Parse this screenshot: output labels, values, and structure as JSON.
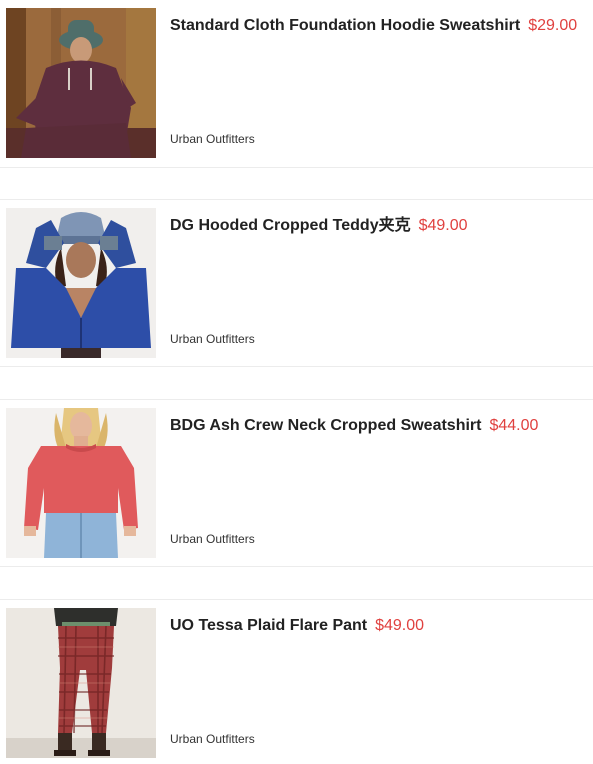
{
  "colors": {
    "price": "#e0413f",
    "title": "#222222",
    "divider": "#ececec"
  },
  "products": [
    {
      "title": "Standard Cloth Foundation Hoodie Sweatshirt",
      "price": "$29.00",
      "brand": "Urban Outfitters",
      "image_icon": "hoodie-photo"
    },
    {
      "title": "DG Hooded Cropped Teddy夹克",
      "price": "$49.00",
      "brand": "Urban Outfitters",
      "image_icon": "teddy-jacket-photo"
    },
    {
      "title": "BDG Ash Crew Neck Cropped Sweatshirt",
      "price": "$44.00",
      "brand": "Urban Outfitters",
      "image_icon": "sweatshirt-photo"
    },
    {
      "title": "UO Tessa Plaid Flare Pant",
      "price": "$49.00",
      "brand": "Urban Outfitters",
      "image_icon": "plaid-pant-photo"
    }
  ]
}
